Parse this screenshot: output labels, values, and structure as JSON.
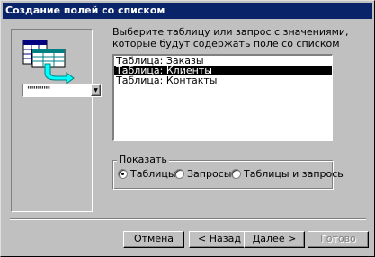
{
  "window": {
    "title": "Создание полей со списком"
  },
  "illustration": {
    "combo_value": "\"\"\"\"\"\"\""
  },
  "prompt": "Выберите таблицу или запрос с значениями, которые будут содержать поле со списком",
  "listbox": {
    "items": [
      {
        "label": "Таблица: Заказы",
        "selected": false
      },
      {
        "label": "Таблица: Клиенты",
        "selected": true
      },
      {
        "label": "Таблица: Контакты",
        "selected": false
      }
    ]
  },
  "show_group": {
    "label": "Показать",
    "options": [
      {
        "label": "Таблицы",
        "checked": true
      },
      {
        "label": "Запросы",
        "checked": false
      },
      {
        "label": "Таблицы и запросы",
        "checked": false
      }
    ]
  },
  "buttons": {
    "cancel": "Отмена",
    "back": "< Назад",
    "next": "Далее >",
    "finish": "Готово"
  },
  "colors": {
    "titlebar": "#0a246a",
    "face": "#c0c0c0",
    "selection": "#000000"
  }
}
